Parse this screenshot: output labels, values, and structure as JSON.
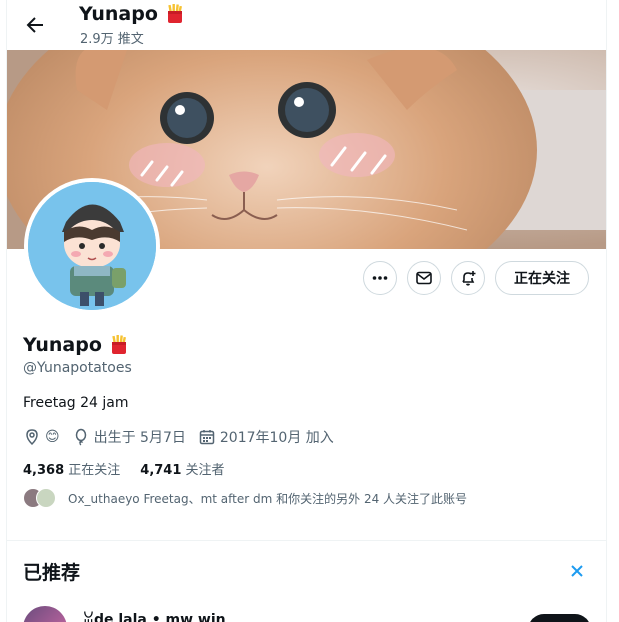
{
  "header": {
    "back_label": "back",
    "title": "Yunapo",
    "tweet_count": "2.9万 推文"
  },
  "profile": {
    "display_name": "Yunapo",
    "handle": "@Yunapotatoes",
    "bio": "Freetag 24 jam",
    "location_emoji": "😊",
    "birthday": "出生于 5月7日",
    "joined": "2017年10月 加入",
    "following_count": "4,368",
    "following_label": "正在关注",
    "followers_count": "4,741",
    "followers_label": "关注者",
    "followers_you_know": "Ox_uthaeyo Freetag、mt after dm 和你关注的另外 24 人关注了此账号",
    "follow_button": "正在关注"
  },
  "recommended": {
    "title": "已推荐",
    "first_item_name": "ꈍde lala • mw win"
  },
  "icons": {
    "back": "arrow-left-icon",
    "more": "more-icon",
    "message": "mail-icon",
    "notify": "bell-plus-icon",
    "location": "location-pin-icon",
    "birthday": "balloon-icon",
    "calendar": "calendar-icon",
    "close": "close-icon",
    "fries": "fries-emoji-icon"
  },
  "colors": {
    "accent": "#1d9bf0",
    "text": "#0f1419",
    "muted": "#536471",
    "avatar_bg": "#78c3ec"
  }
}
